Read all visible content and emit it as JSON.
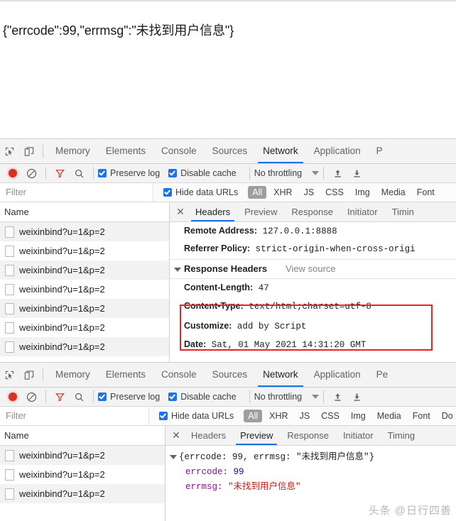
{
  "page": {
    "response_body": "{\"errcode\":99,\"errmsg\":\"未找到用户信息\"}"
  },
  "devtools_top": {
    "icons": {
      "inspect": "inspect-element-icon",
      "device": "device-toolbar-icon"
    },
    "tabs": [
      {
        "label": "Memory",
        "active": false
      },
      {
        "label": "Elements",
        "active": false
      },
      {
        "label": "Console",
        "active": false
      },
      {
        "label": "Sources",
        "active": false
      },
      {
        "label": "Network",
        "active": true
      },
      {
        "label": "Application",
        "active": false
      },
      {
        "label": "P",
        "active": false
      }
    ],
    "toolbar": {
      "record_label": "record-button",
      "clear_label": "clear-button",
      "filter_icon": "filter-icon",
      "search_icon": "search-icon",
      "preserve_log": "Preserve log",
      "preserve_log_checked": true,
      "disable_cache": "Disable cache",
      "disable_cache_checked": true,
      "throttling": "No throttling",
      "import_icon": "import-har-icon",
      "export_icon": "export-har-icon"
    },
    "filterbar": {
      "filter_placeholder": "Filter",
      "hide_data_urls": "Hide data URLs",
      "hide_data_urls_checked": true,
      "types": [
        "All",
        "XHR",
        "JS",
        "CSS",
        "Img",
        "Media",
        "Font"
      ],
      "active_type": "All"
    },
    "names": {
      "header": "Name",
      "rows": [
        "weixinbind?u=1&p=2",
        "weixinbind?u=1&p=2",
        "weixinbind?u=1&p=2",
        "weixinbind?u=1&p=2",
        "weixinbind?u=1&p=2",
        "weixinbind?u=1&p=2",
        "weixinbind?u=1&p=2"
      ]
    },
    "detail": {
      "tabs": [
        {
          "label": "Headers",
          "active": true
        },
        {
          "label": "Preview",
          "active": false
        },
        {
          "label": "Response",
          "active": false
        },
        {
          "label": "Initiator",
          "active": false
        },
        {
          "label": "Timin",
          "active": false
        }
      ],
      "close_label": "✕",
      "general_rows": [
        {
          "key": "Remote Address:",
          "value": "127.0.0.1:8888"
        },
        {
          "key": "Referrer Policy:",
          "value": "strict-origin-when-cross-origi"
        }
      ],
      "section": {
        "title": "Response Headers",
        "view_source": "View source"
      },
      "response_rows": [
        {
          "key": "Content-Length:",
          "value": "47"
        },
        {
          "key": "Content-Type:",
          "value": "text/html;charset=utf-8"
        },
        {
          "key": "Customize:",
          "value": "add by Script"
        },
        {
          "key": "Date:",
          "value": "Sat, 01 May 2021 14:31:20 GMT"
        }
      ],
      "highlight_color": "#ee2222"
    }
  },
  "devtools_bottom": {
    "tabs": [
      {
        "label": "Memory",
        "active": false
      },
      {
        "label": "Elements",
        "active": false
      },
      {
        "label": "Console",
        "active": false
      },
      {
        "label": "Sources",
        "active": false
      },
      {
        "label": "Network",
        "active": true
      },
      {
        "label": "Application",
        "active": false
      },
      {
        "label": "Pe",
        "active": false
      }
    ],
    "toolbar": {
      "preserve_log": "Preserve log",
      "preserve_log_checked": true,
      "disable_cache": "Disable cache",
      "disable_cache_checked": true,
      "throttling": "No throttling"
    },
    "filterbar": {
      "filter_placeholder": "Filter",
      "hide_data_urls": "Hide data URLs",
      "hide_data_urls_checked": true,
      "types": [
        "All",
        "XHR",
        "JS",
        "CSS",
        "Img",
        "Media",
        "Font",
        "Do"
      ],
      "active_type": "All"
    },
    "names": {
      "header": "Name",
      "rows": [
        "weixinbind?u=1&p=2",
        "weixinbind?u=1&p=2",
        "weixinbind?u=1&p=2"
      ]
    },
    "detail": {
      "tabs": [
        {
          "label": "Headers",
          "active": false
        },
        {
          "label": "Preview",
          "active": true
        },
        {
          "label": "Response",
          "active": false
        },
        {
          "label": "Initiator",
          "active": false
        },
        {
          "label": "Timing",
          "active": false
        }
      ],
      "close_label": "✕",
      "preview": {
        "root_prefix": "{errcode: ",
        "root_errcode": "99",
        "root_mid": ", errmsg: ",
        "root_errmsg": "\"未找到用户信息\"",
        "root_suffix": "}",
        "child1_key": "errcode: ",
        "child1_val": "99",
        "child2_key": "errmsg: ",
        "child2_val": "\"未找到用户信息\""
      }
    }
  },
  "watermark": {
    "text": "头条 @日行四善"
  }
}
